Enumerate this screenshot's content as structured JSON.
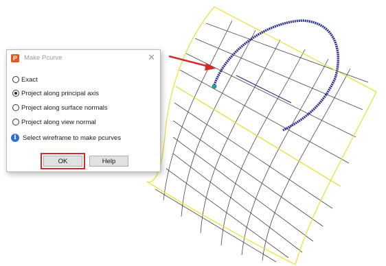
{
  "dialog": {
    "app_icon_letter": "P",
    "title": "Make Pcurve",
    "options": [
      {
        "label": "Exact",
        "checked": false
      },
      {
        "label": "Project along principal axis",
        "checked": true
      },
      {
        "label": "Project along surface normals",
        "checked": false
      },
      {
        "label": "Project along view normal",
        "checked": false
      }
    ],
    "info_text": "Select wireframe to make pcurves",
    "ok_label": "OK",
    "help_label": "Help"
  },
  "colors": {
    "surface_edge": "#e8e02a",
    "grid_lines": "#444444",
    "curve": "#2a2f8f",
    "arrow": "#d42a2a",
    "highlight": "#d42a2a",
    "control_point": "#2aa6a6"
  },
  "icons": {
    "info": "info-icon",
    "close": "close-icon",
    "app": "app-icon"
  }
}
